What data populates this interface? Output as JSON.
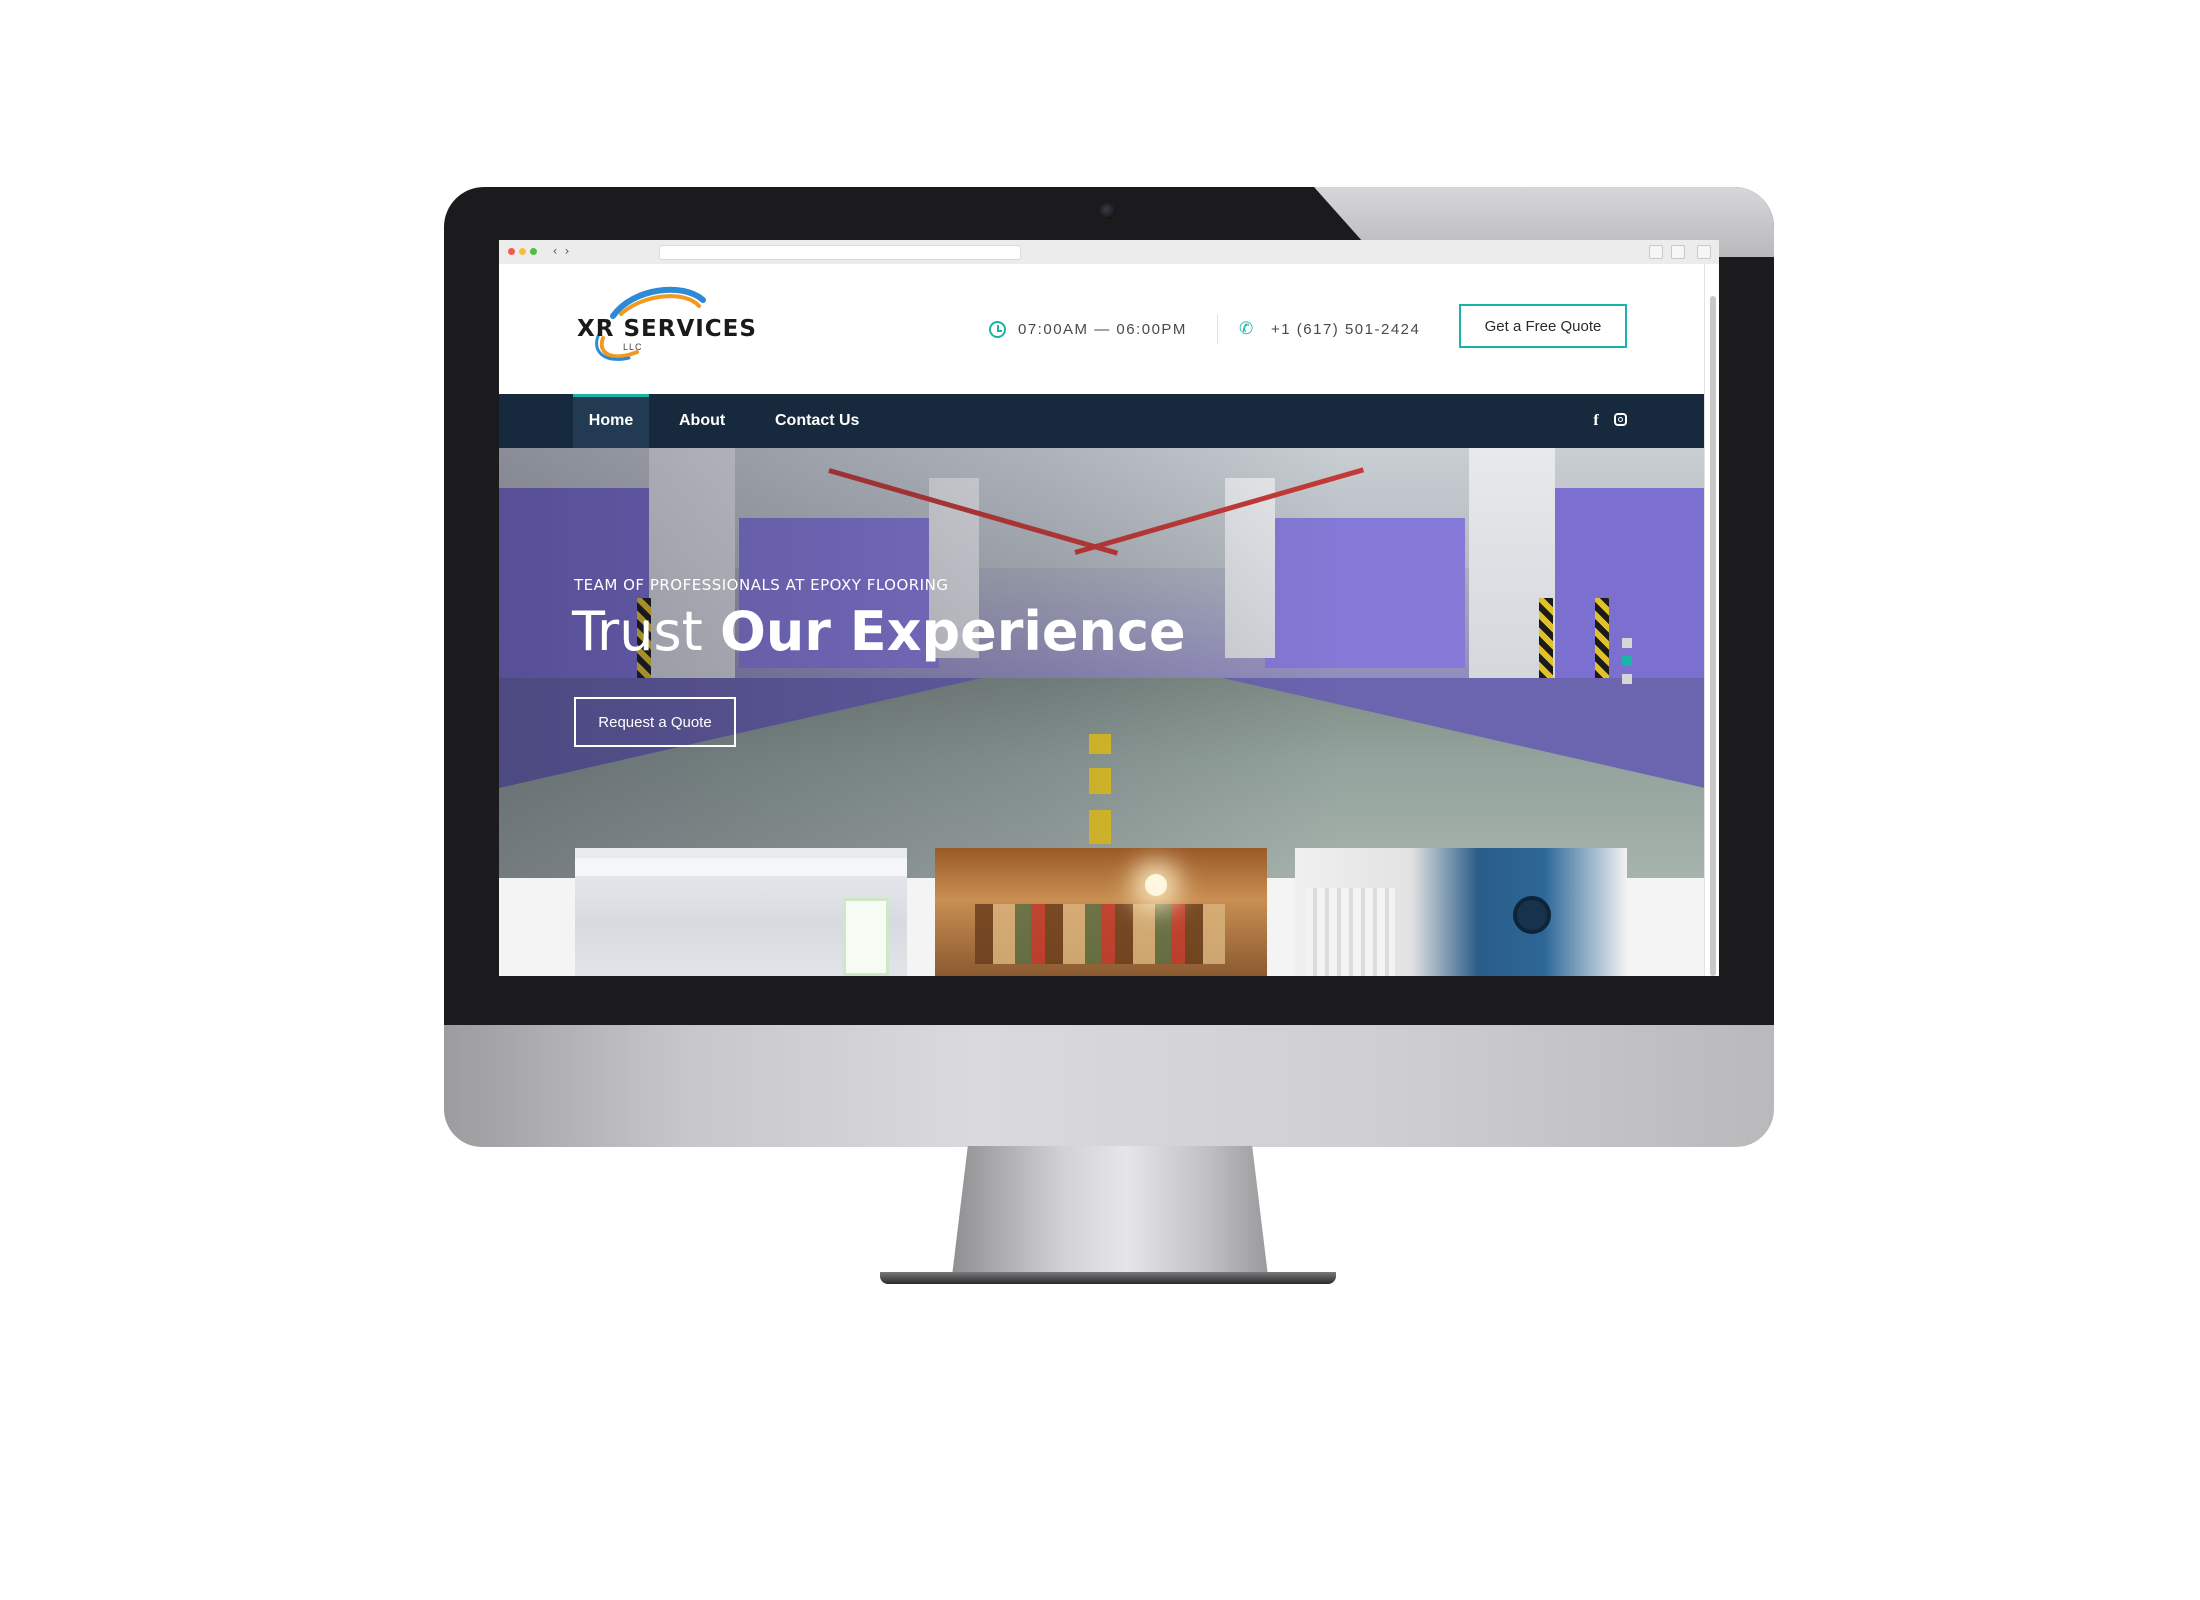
{
  "browser": {
    "back_symbol": "‹",
    "forward_symbol": "›"
  },
  "header": {
    "logo_text": "XR SERVICES",
    "logo_sub": "LLC",
    "hours": "07:00AM — 06:00PM",
    "phone": "+1 (617) 501-2424",
    "cta_label": "Get a Free Quote"
  },
  "nav": {
    "items": [
      {
        "label": "Home"
      },
      {
        "label": "About"
      },
      {
        "label": "Contact Us"
      }
    ],
    "social": {
      "facebook_glyph": "f",
      "icons": [
        "facebook-icon",
        "instagram-icon"
      ]
    }
  },
  "hero": {
    "eyebrow": "TEAM OF PROFESSIONALS AT EPOXY FLOORING",
    "title_light": "Trust ",
    "title_bold": "Our Experience",
    "button_label": "Request a Quote",
    "slide_count": 3,
    "active_slide": 2
  },
  "colors": {
    "accent": "#1ab3a6",
    "navbar": "#17293d",
    "hero_purple": "#7b6fd0"
  }
}
